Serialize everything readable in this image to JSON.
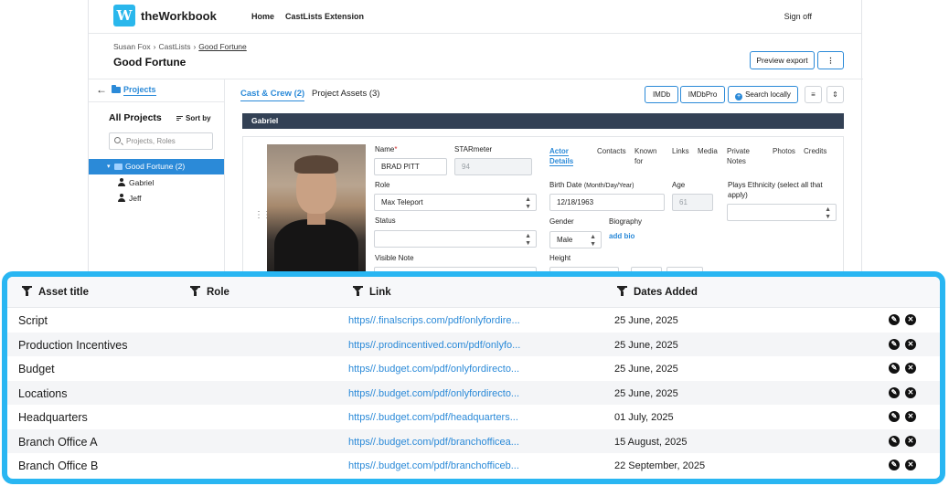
{
  "app": {
    "logo_letter": "W",
    "name": "theWorkbook"
  },
  "nav": {
    "home": "Home",
    "extension": "CastLists Extension",
    "signoff": "Sign off"
  },
  "breadcrumb": {
    "user": "Susan Fox",
    "section": "CastLists",
    "current": "Good Fortune",
    "sep": "›"
  },
  "page": {
    "title": "Good Fortune",
    "preview_export": "Preview export",
    "more": "⋮"
  },
  "left": {
    "projects_tab": "Projects",
    "all_projects": "All Projects",
    "sort_by": "Sort by",
    "search_placeholder": "Projects, Roles",
    "selected_project": "Good Fortune (2)",
    "children": [
      "Gabriel",
      "Jeff"
    ]
  },
  "tabs": {
    "cast": "Cast & Crew (2)",
    "assets": "Project Assets (3)"
  },
  "actions": {
    "imdb": "IMDb",
    "imdbpro": "IMDbPro",
    "search_locally": "Search locally"
  },
  "role_bar": "Gabriel",
  "form": {
    "name_label": "Name",
    "name_value": "BRAD PITT",
    "starmeter_label": "STARmeter",
    "starmeter_value": "94",
    "role_label": "Role",
    "role_value": "Max Teleport",
    "status_label": "Status",
    "status_value": "",
    "visible_note_label": "Visible Note",
    "birth_label": "Birth Date",
    "birth_hint": "(Month/Day/Year)",
    "birth_value": "12/18/1963",
    "age_label": "Age",
    "age_value": "61",
    "gender_label": "Gender",
    "gender_value": "Male",
    "biography_label": "Biography",
    "add_bio": "add bio",
    "height_label": "Height",
    "ethnicity_label": "Plays Ethnicity (select all that apply)"
  },
  "subtabs": [
    {
      "label": "Actor Details"
    },
    {
      "label": "Contacts"
    },
    {
      "label": "Known for"
    },
    {
      "label": "Links"
    },
    {
      "label": "Media"
    },
    {
      "label": "Private Notes"
    },
    {
      "label": "Photos"
    },
    {
      "label": "Credits"
    }
  ],
  "table": {
    "columns": [
      "Asset title",
      "Role",
      "Link",
      "Dates Added"
    ],
    "rows": [
      {
        "title": "Script",
        "link": "https//.finalscrips.com/pdf/onlyfordire...",
        "date": "25 June, 2025"
      },
      {
        "title": "Production Incentives",
        "link": "https//.prodincentived.com/pdf/onlyfo...",
        "date": "25 June, 2025"
      },
      {
        "title": "Budget",
        "link": "https//.budget.com/pdf/onlyfordirecto...",
        "date": "25 June, 2025"
      },
      {
        "title": "Locations",
        "link": "https//.budget.com/pdf/onlyfordirecto...",
        "date": "25 June, 2025"
      },
      {
        "title": "Headquarters",
        "link": "https//.budget.com/pdf/headquarters...",
        "date": "01 July, 2025"
      },
      {
        "title": "Branch Office A",
        "link": "https//.budget.com/pdf/branchofficea...",
        "date": "15 August, 2025"
      },
      {
        "title": "Branch Office B",
        "link": "https//.budget.com/pdf/branchofficeb...",
        "date": "22 September, 2025"
      }
    ]
  },
  "colors": {
    "accent": "#2b8ad8",
    "highlight_border": "#29b6f2",
    "role_bar": "#334155"
  }
}
